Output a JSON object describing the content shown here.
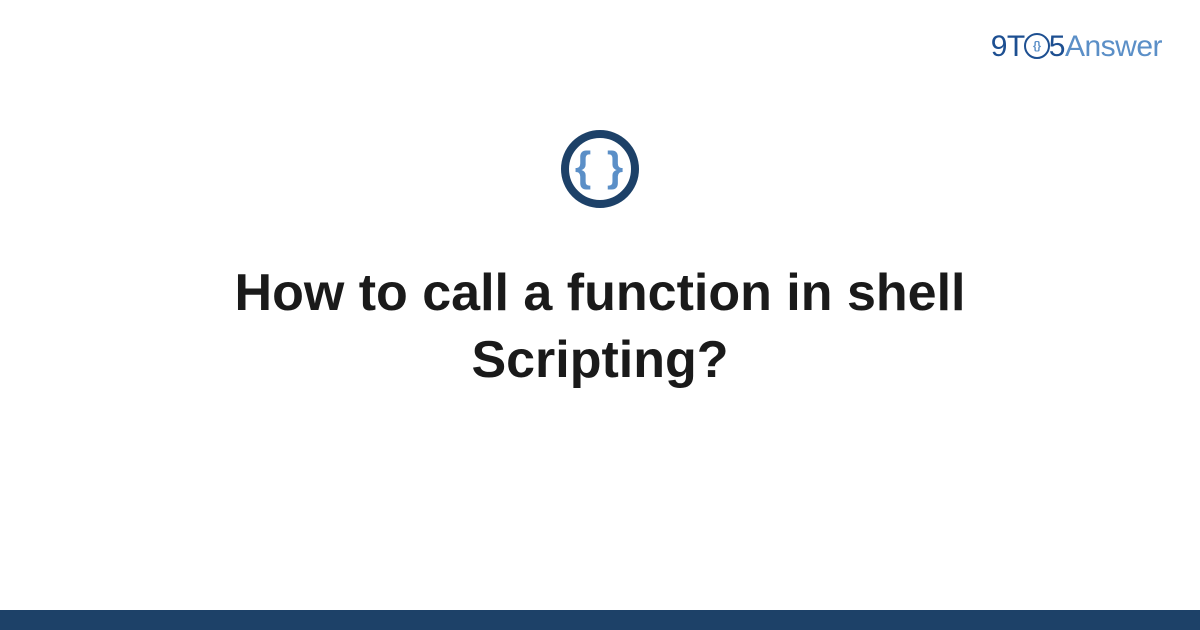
{
  "logo": {
    "part1": "9T",
    "part2": "5",
    "part3": "Answer"
  },
  "icon": {
    "braces": "{ }"
  },
  "title": "How to call a function in shell Scripting?"
}
